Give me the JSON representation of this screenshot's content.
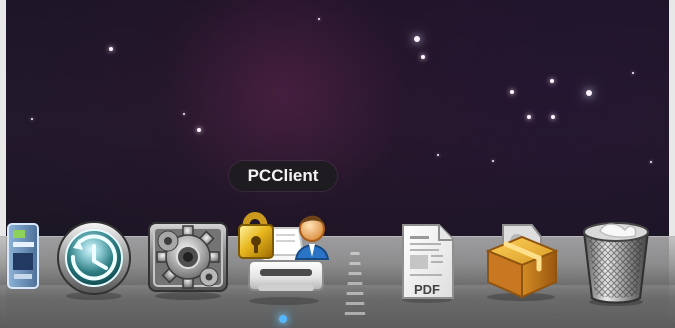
{
  "dock": {
    "tooltip": "PCClient",
    "document_badge": "PDF",
    "items": [
      {
        "name": "partial-app-icon"
      },
      {
        "name": "time-machine-icon"
      },
      {
        "name": "system-preferences-icon"
      },
      {
        "name": "pcclient-icon"
      },
      {
        "name": "pdf-document-icon"
      },
      {
        "name": "package-installer-icon"
      },
      {
        "name": "trash-icon"
      }
    ]
  },
  "colors": {
    "tooltip_background": "#1c1c1e",
    "tooltip_text": "#f4f4f4",
    "running_indicator": "#55b7ff"
  }
}
